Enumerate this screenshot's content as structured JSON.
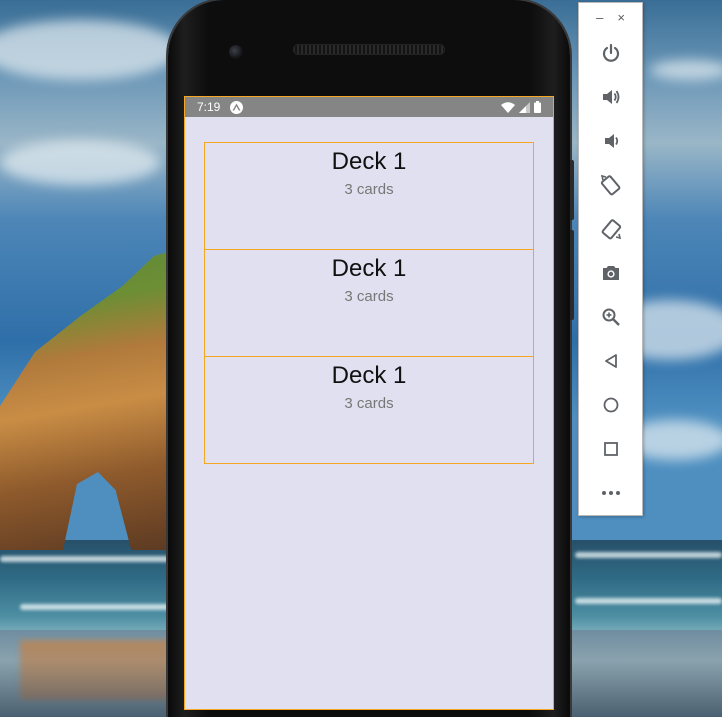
{
  "status_bar": {
    "time": "7:19",
    "notification_icon": "expo-icon"
  },
  "decks": [
    {
      "title": "Deck 1",
      "count": "3 cards"
    },
    {
      "title": "Deck 1",
      "count": "3 cards"
    },
    {
      "title": "Deck 1",
      "count": "3 cards"
    }
  ],
  "emulator_toolbar": {
    "minimize": "–",
    "close": "×",
    "tools": [
      {
        "icon": "power-icon"
      },
      {
        "icon": "volume-up-icon"
      },
      {
        "icon": "volume-down-icon"
      },
      {
        "icon": "rotate-left-icon"
      },
      {
        "icon": "rotate-right-icon"
      },
      {
        "icon": "camera-icon"
      },
      {
        "icon": "zoom-icon"
      },
      {
        "icon": "back-icon"
      },
      {
        "icon": "home-icon"
      },
      {
        "icon": "overview-icon"
      },
      {
        "icon": "more-icon"
      }
    ]
  },
  "colors": {
    "screen_background": "#e0e0f0",
    "card_border": "#f5a623",
    "status_bar": "#858585",
    "toolbar_icon": "#5f6368"
  }
}
